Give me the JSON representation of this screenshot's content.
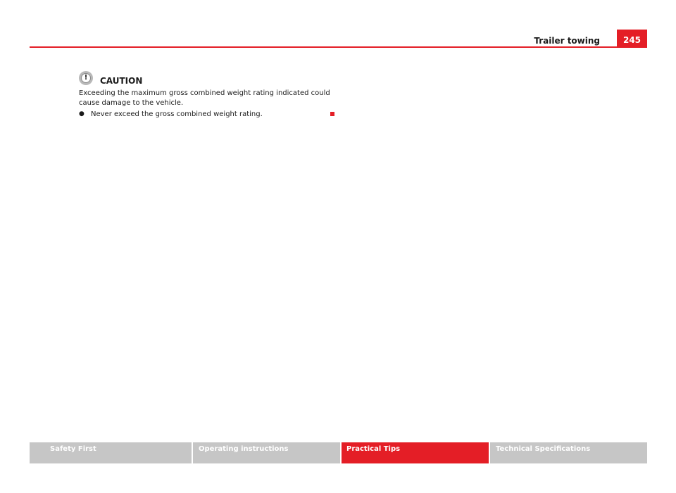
{
  "header": {
    "section_title": "Trailer towing",
    "page_number": "245"
  },
  "caution": {
    "icon": "exclamation-circle-icon",
    "title": "CAUTION",
    "text": "Exceeding the maximum gross combined weight rating indicated could cause damage to the vehicle.",
    "bullets": [
      "Never exceed the gross combined weight rating."
    ]
  },
  "footer": {
    "tabs": [
      {
        "label": "Safety First",
        "active": false
      },
      {
        "label": "Operating instructions",
        "active": false
      },
      {
        "label": "Practical Tips",
        "active": true
      },
      {
        "label": "Technical Specifications",
        "active": false
      }
    ]
  },
  "colors": {
    "accent": "#e41e26",
    "tab_inactive": "#c6c6c6",
    "text": "#1a1a1a"
  }
}
